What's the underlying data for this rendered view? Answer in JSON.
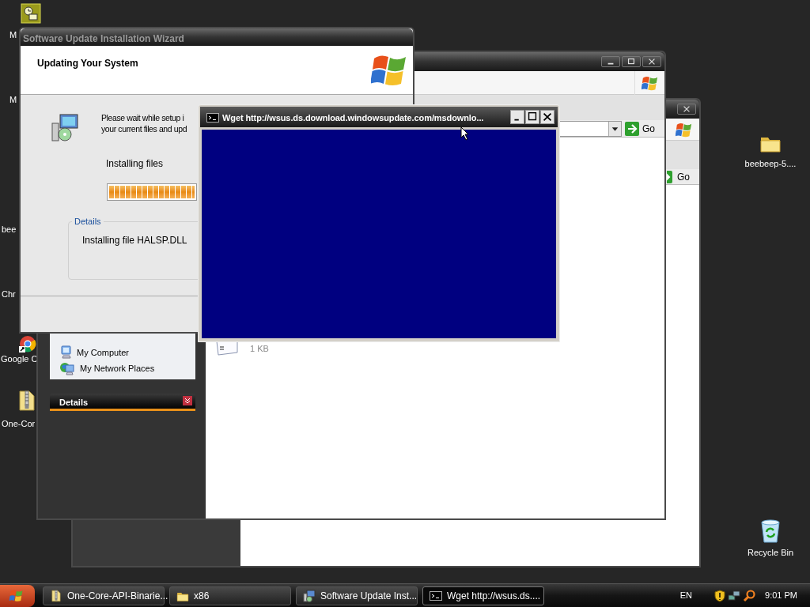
{
  "desktop_icons": [
    {
      "kind": "program",
      "label": "M"
    },
    {
      "label": "M"
    },
    {
      "label": "bee"
    },
    {
      "label": "Chr"
    },
    {
      "kind": "chrome",
      "label": "Google C"
    },
    {
      "kind": "zip",
      "label": "One-Cor"
    },
    {
      "kind": "folder",
      "label": "beebeep-5...."
    },
    {
      "kind": "recycle",
      "label": "Recycle Bin"
    }
  ],
  "explorer_back": {
    "go_button": "Go"
  },
  "explorer_front": {
    "go_button": "Go",
    "tasks": [
      {
        "kind": "computer",
        "label": "My Computer"
      },
      {
        "kind": "network",
        "label": "My Network Places"
      }
    ],
    "details_header": "Details",
    "files": [
      {
        "size": "1 KB"
      }
    ]
  },
  "wizard": {
    "title": "Software Update Installation Wizard",
    "active": false,
    "heading": "Updating Your System",
    "message_lines": [
      "Please wait while setup i",
      "your current files and upd"
    ],
    "status": "Installing files",
    "progress": {
      "level": 1
    },
    "details_legend": "Details",
    "details_text": "Installing file HALSP.DLL"
  },
  "console": {
    "title": "Wget http://wsus.ds.download.windowsupdate.com/msdownlo...",
    "active": true
  },
  "taskbar": {
    "buttons": [
      {
        "kind": "zip",
        "label": "One-Core-API-Binarie...",
        "selected": false
      },
      {
        "kind": "folder",
        "label": "x86",
        "selected": false
      },
      {
        "kind": "setup",
        "label": "Software Update Inst...",
        "selected": false
      },
      {
        "kind": "console",
        "label": "Wget http://wsus.ds....",
        "selected": true
      }
    ],
    "language": "EN",
    "clock": "9:01 PM"
  }
}
